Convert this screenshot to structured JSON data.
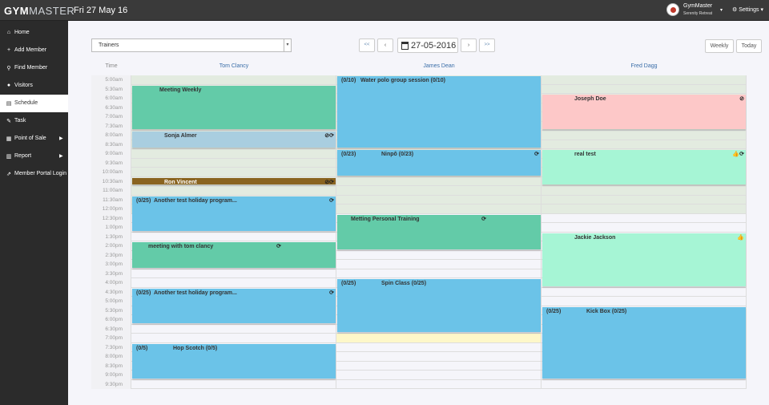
{
  "brand": {
    "logo_bold": "GYM",
    "logo_rest": "MASTER",
    "date": "Fri 27 May 16"
  },
  "user": {
    "name": "GymMaster",
    "subtitle": "Serenity Retreat",
    "caret": "▾"
  },
  "settings": {
    "label": "⚙ Settings ▾"
  },
  "sidebar": {
    "items": [
      {
        "icon": "⌂",
        "label": "Home",
        "name": "home"
      },
      {
        "icon": "+",
        "label": "Add Member",
        "name": "add-member"
      },
      {
        "icon": "⚲",
        "label": "Find Member",
        "name": "find-member"
      },
      {
        "icon": "●",
        "label": "Visitors",
        "name": "visitors"
      },
      {
        "icon": "▤",
        "label": "Schedule",
        "name": "schedule",
        "active": true
      },
      {
        "icon": "✎",
        "label": "Task",
        "name": "task"
      },
      {
        "icon": "▦",
        "label": "Point of Sale",
        "name": "point-of-sale",
        "arrow": "▶"
      },
      {
        "icon": "▥",
        "label": "Report",
        "name": "report",
        "arrow": "▶"
      },
      {
        "icon": "⇗",
        "label": "Member Portal Login",
        "name": "member-portal-login"
      }
    ]
  },
  "toolbar": {
    "select_value": "Trainers",
    "select_caret": "▾",
    "first": "<<",
    "prev": "‹",
    "date": "27-05-2016",
    "next": "›",
    "last": ">>",
    "weekly": "Weekly",
    "today": "Today"
  },
  "columns": {
    "time": "Time",
    "trainers": [
      "Tom Clancy",
      "James Dean",
      "Fred Dagg"
    ]
  },
  "times": [
    "5:00am",
    "5:30am",
    "6:00am",
    "6:30am",
    "7:00am",
    "7:30am",
    "8:00am",
    "8:30am",
    "9:00am",
    "9:30am",
    "10:00am",
    "10:30am",
    "11:00am",
    "11:30am",
    "12:00pm",
    "12:30pm",
    "1:00pm",
    "1:30pm",
    "2:00pm",
    "2:30pm",
    "3:00pm",
    "3:30pm",
    "4:00pm",
    "4:30pm",
    "5:00pm",
    "5:30pm",
    "6:00pm",
    "6:30pm",
    "7:00pm",
    "7:30pm",
    "8:00pm",
    "8:30pm",
    "9:00pm",
    "9:30pm"
  ],
  "events": [
    {
      "col": 0,
      "start": 1,
      "end": 6,
      "color": "c-green",
      "count": "",
      "title": "Meeting Weekly",
      "icons": ""
    },
    {
      "col": 0,
      "start": 6,
      "end": 8,
      "color": "c-grey",
      "count": "",
      "title": "Sonja Almer",
      "icons": "⊘⟳"
    },
    {
      "col": 0,
      "start": 11,
      "end": 12,
      "color": "c-brown",
      "count": "",
      "title": "Ron Vincent",
      "icons": "⊘⟳"
    },
    {
      "col": 0,
      "start": 13,
      "end": 17,
      "color": "c-blue",
      "count": "(0/25)",
      "title": "Another test holiday program...",
      "icons": "⟳"
    },
    {
      "col": 0,
      "start": 18,
      "end": 21,
      "color": "c-green",
      "count": "",
      "title": "meeting with tom clancy",
      "icons": "⟳"
    },
    {
      "col": 0,
      "start": 23,
      "end": 27,
      "color": "c-blue",
      "count": "(0/25)",
      "title": "Another test holiday program...",
      "icons": "⟳"
    },
    {
      "col": 0,
      "start": 29,
      "end": 33,
      "color": "c-blue",
      "count": "(0/5)",
      "title": "Hop Scotch (0/5)",
      "icons": ""
    },
    {
      "col": 1,
      "start": 0,
      "end": 8,
      "color": "c-blue",
      "count": "(0/10)",
      "title": "Water polo group session (0/10)",
      "icons": ""
    },
    {
      "col": 1,
      "start": 8,
      "end": 11,
      "color": "c-blue",
      "count": "(0/23)",
      "title": "Ninpô (0/23)",
      "icons": "⟳"
    },
    {
      "col": 1,
      "start": 15,
      "end": 19,
      "color": "c-green",
      "count": "",
      "title": "Metting Personal Training",
      "icons": "⟳"
    },
    {
      "col": 1,
      "start": 22,
      "end": 28,
      "color": "c-blue",
      "count": "(0/25)",
      "title": "Spin Class (0/25)",
      "icons": ""
    },
    {
      "col": 2,
      "start": 2,
      "end": 6,
      "color": "c-pink",
      "count": "",
      "title": "Joseph Doe",
      "icons": "⊘"
    },
    {
      "col": 2,
      "start": 8,
      "end": 12,
      "color": "c-mint",
      "count": "",
      "title": "real test",
      "icons": "👍⟳"
    },
    {
      "col": 2,
      "start": 17,
      "end": 23,
      "color": "c-mint",
      "count": "",
      "title": "Jackie Jackson",
      "icons": "👍"
    },
    {
      "col": 2,
      "start": 25,
      "end": 33,
      "color": "c-blue",
      "count": "(0/25)",
      "title": "Kick Box (0/25)",
      "icons": ""
    }
  ]
}
